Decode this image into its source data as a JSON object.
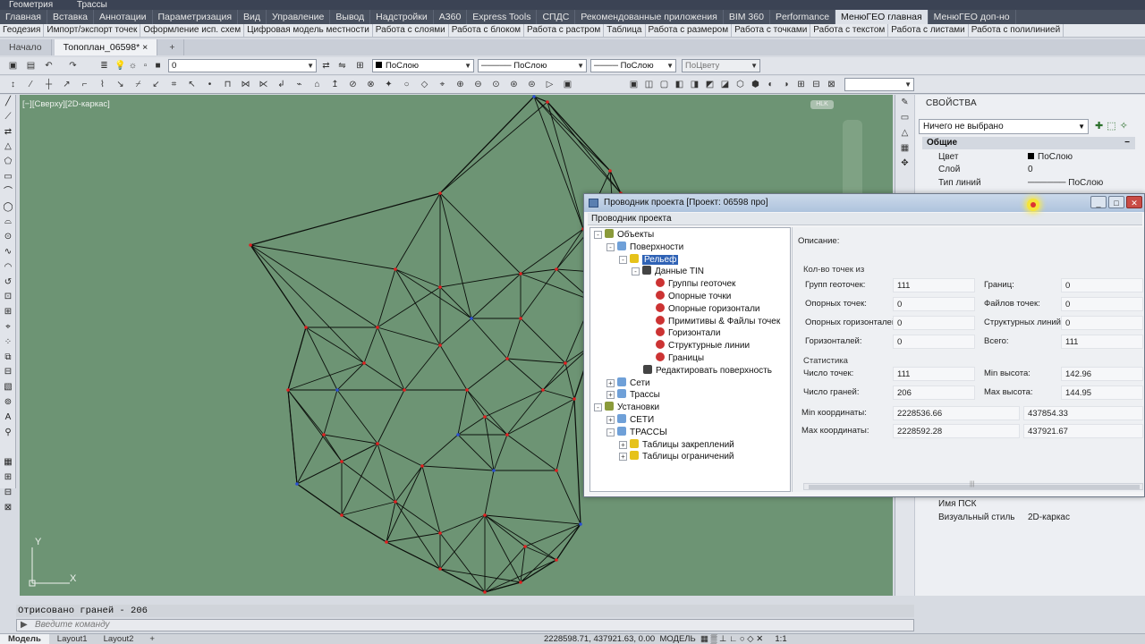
{
  "top_menu": [
    "Геометрия",
    "Трассы"
  ],
  "ribbon_tabs": [
    "Главная",
    "Вставка",
    "Аннотации",
    "Параметризация",
    "Вид",
    "Управление",
    "Вывод",
    "Надстройки",
    "A360",
    "Express Tools",
    "СПДС",
    "Рекомендованные приложения",
    "BIM 360",
    "Performance",
    "МенюГЕО главная",
    "МенюГЕО доп-но"
  ],
  "ribbon_active": "МенюГЕО главная",
  "ribbon_subtabs": [
    "Геодезия",
    "Импорт/экспорт точек",
    "Оформление исп. схем",
    "Цифровая модель местности",
    "Работа с слоями",
    "Работа с блоком",
    "Работа с растром",
    "Таблица",
    "Работа с размером",
    "Работа с точками",
    "Работа с текстом",
    "Работа с листами",
    "Работа с полилинией"
  ],
  "file_tabs": [
    "Начало",
    "Топоплан_06598*"
  ],
  "toolbar": {
    "layer_value": "0",
    "color_value": "ПоСлою",
    "linetype_value": "ПоСлою",
    "lineweight_value": "ПоСлою",
    "plotstyle_value": "ПоЦвету"
  },
  "viewport": {
    "label": "[−][Сверху][2D-каркас]",
    "ucs_y": "Y",
    "ucs_x": "X",
    "navcube": "HLK"
  },
  "properties": {
    "title": "СВОЙСТВА",
    "selection": "Ничего не выбрано",
    "group": "Общие",
    "rows": [
      {
        "label": "Цвет",
        "value": "ПоСлою"
      },
      {
        "label": "Слой",
        "value": "0"
      },
      {
        "label": "Тип линий",
        "value": "ПоСлою"
      }
    ],
    "bottom_rows": [
      {
        "label": "Имя ПСК",
        "value": ""
      },
      {
        "label": "Визуальный стиль",
        "value": "2D-каркас"
      }
    ]
  },
  "dialog": {
    "title": "Проводник проекта [Проект: 06598 про]",
    "subtitle": "Проводник проекта",
    "tree": [
      {
        "label": "Объекты",
        "level": 0,
        "exp": "-"
      },
      {
        "label": "Поверхности",
        "level": 1,
        "exp": "-"
      },
      {
        "label": "Рельеф",
        "level": 2,
        "exp": "-",
        "selected": true
      },
      {
        "label": "Данные TIN",
        "level": 3,
        "exp": "-"
      },
      {
        "label": "Группы геоточек",
        "level": 4,
        "exp": ""
      },
      {
        "label": "Опорные точки",
        "level": 4,
        "exp": ""
      },
      {
        "label": "Опорные горизонтали",
        "level": 4,
        "exp": ""
      },
      {
        "label": "Примитивы & Файлы точек",
        "level": 4,
        "exp": ""
      },
      {
        "label": "Горизонтали",
        "level": 4,
        "exp": ""
      },
      {
        "label": "Структурные линии",
        "level": 4,
        "exp": ""
      },
      {
        "label": "Границы",
        "level": 4,
        "exp": ""
      },
      {
        "label": "Редактировать поверхность",
        "level": 3,
        "exp": ""
      },
      {
        "label": "Сети",
        "level": 1,
        "exp": "+"
      },
      {
        "label": "Трассы",
        "level": 1,
        "exp": "+"
      },
      {
        "label": "Установки",
        "level": 0,
        "exp": "-"
      },
      {
        "label": "СЕТИ",
        "level": 1,
        "exp": "+"
      },
      {
        "label": "ТРАССЫ",
        "level": 1,
        "exp": "-"
      },
      {
        "label": "Таблицы закреплений",
        "level": 2,
        "exp": "+"
      },
      {
        "label": "Таблицы ограничений",
        "level": 2,
        "exp": "+"
      }
    ],
    "description_label": "Описание:",
    "counts_section": "Кол-во точек из",
    "counts": [
      {
        "l1": "Групп геоточек:",
        "v1": "111",
        "l2": "Границ:",
        "v2": "0"
      },
      {
        "l1": "Опорных точек:",
        "v1": "0",
        "l2": "Файлов точек:",
        "v2": "0"
      },
      {
        "l1": "Опорных горизонталей:",
        "v1": "0",
        "l2": "Структурных линий",
        "v2": "0"
      },
      {
        "l1": "Горизонталей:",
        "v1": "0",
        "l2": "Всего:",
        "v2": "111"
      }
    ],
    "stats_section": "Статистика",
    "stats": [
      {
        "l1": "Число точек:",
        "v1": "111",
        "l2": "Min высота:",
        "v2": "142.96"
      },
      {
        "l1": "Число граней:",
        "v1": "206",
        "l2": "Max высота:",
        "v2": "144.95"
      }
    ],
    "coords": [
      {
        "label": "Min координаты:",
        "x": "2228536.66",
        "y": "437854.33"
      },
      {
        "label": "Max координаты:",
        "x": "2228592.28",
        "y": "437921.67"
      }
    ],
    "hscroll_grip": "|||"
  },
  "command": {
    "history": "Отрисовано граней - 206",
    "placeholder": "Введите команду"
  },
  "status": {
    "tabs": [
      "Модель",
      "Layout1",
      "Layout2"
    ],
    "coords": "2228598.71, 437921.63, 0.00",
    "mode": "МОДЕЛЬ",
    "scale": "1:1"
  }
}
